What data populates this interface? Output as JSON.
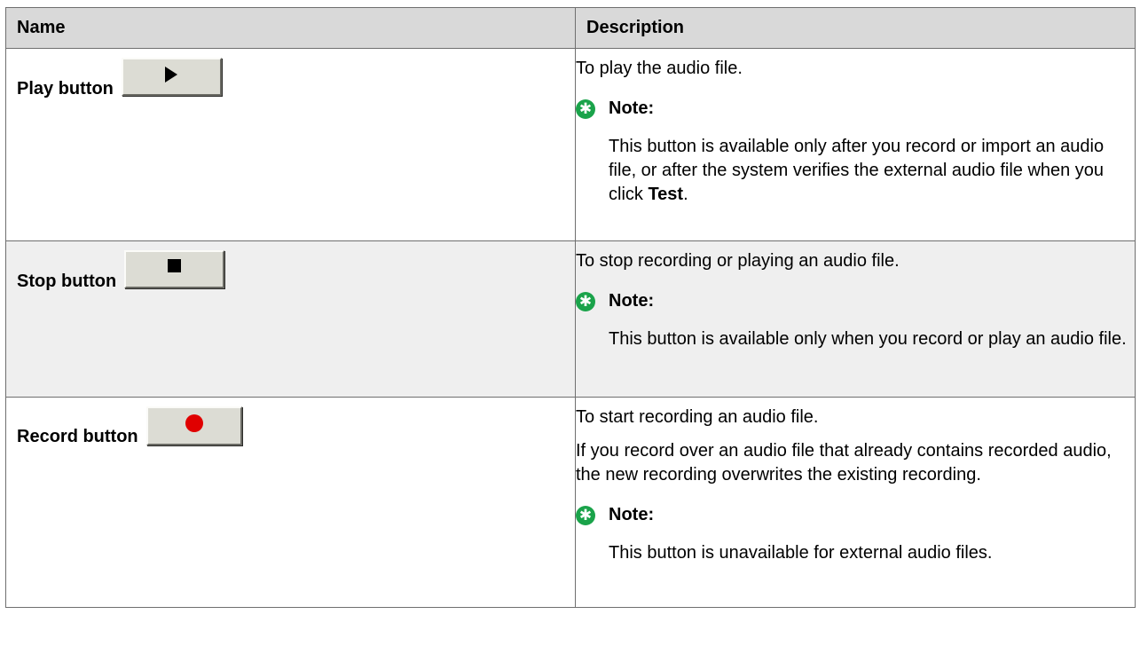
{
  "table": {
    "headers": {
      "name": "Name",
      "description": "Description"
    },
    "rows": [
      {
        "name": "Play button",
        "button_icon": "play-triangle-icon",
        "paragraphs": [
          "To play the audio file."
        ],
        "note_label": "Note:",
        "note_text": "This button is available only after you record or import an audio file, or after the system verifies the external audio file when you click ",
        "note_bold": "Test",
        "note_end": "."
      },
      {
        "name": "Stop button",
        "button_icon": "stop-square-icon",
        "paragraphs": [
          "To stop recording or playing an audio file."
        ],
        "note_label": "Note:",
        "note_text": "This button is available only when you record or play an audio file."
      },
      {
        "name": "Record button",
        "button_icon": "record-dot-icon",
        "paragraphs": [
          "To start recording an audio file.",
          "If you record over an audio file that already contains recorded audio, the new recording overwrites the existing recording."
        ],
        "note_label": "Note:",
        "note_text": "This button is unavailable for external audio files."
      }
    ]
  },
  "colors": {
    "header_bg": "#d9d9d9",
    "border": "#6f6f6f",
    "shaded_row_bg": "#efefef",
    "note_icon": "#1aa34a",
    "record_dot": "#e00000",
    "button_face": "#dcdcd4"
  }
}
